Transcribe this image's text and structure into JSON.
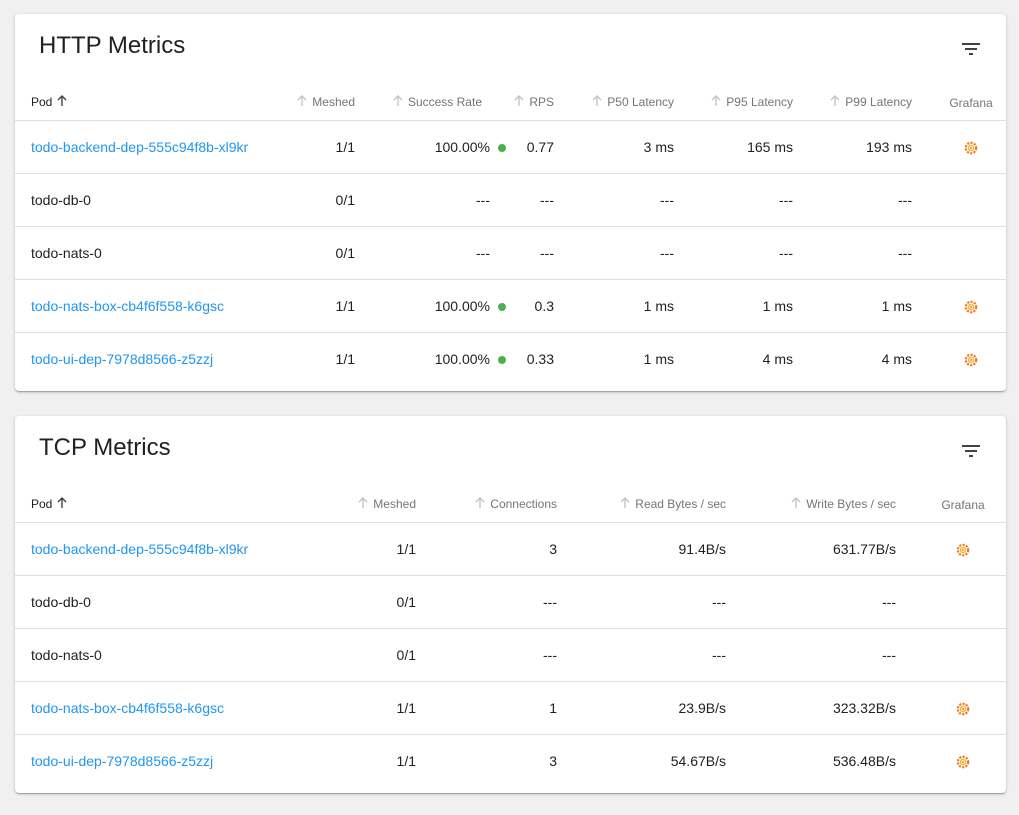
{
  "http": {
    "title": "HTTP Metrics",
    "headers": {
      "pod": "Pod",
      "meshed": "Meshed",
      "success_rate": "Success Rate",
      "rps": "RPS",
      "p50": "P50 Latency",
      "p95": "P95 Latency",
      "p99": "P99 Latency",
      "grafana": "Grafana"
    },
    "rows": [
      {
        "pod": "todo-backend-dep-555c94f8b-xl9kr",
        "linked": true,
        "meshed": "1/1",
        "success_rate": "100.00%",
        "rps": "0.77",
        "p50": "3 ms",
        "p95": "165 ms",
        "p99": "193 ms",
        "grafana": true
      },
      {
        "pod": "todo-db-0",
        "linked": false,
        "meshed": "0/1",
        "success_rate": "---",
        "rps": "---",
        "p50": "---",
        "p95": "---",
        "p99": "---",
        "grafana": false
      },
      {
        "pod": "todo-nats-0",
        "linked": false,
        "meshed": "0/1",
        "success_rate": "---",
        "rps": "---",
        "p50": "---",
        "p95": "---",
        "p99": "---",
        "grafana": false
      },
      {
        "pod": "todo-nats-box-cb4f6f558-k6gsc",
        "linked": true,
        "meshed": "1/1",
        "success_rate": "100.00%",
        "rps": "0.3",
        "p50": "1 ms",
        "p95": "1 ms",
        "p99": "1 ms",
        "grafana": true
      },
      {
        "pod": "todo-ui-dep-7978d8566-z5zzj",
        "linked": true,
        "meshed": "1/1",
        "success_rate": "100.00%",
        "rps": "0.33",
        "p50": "1 ms",
        "p95": "4 ms",
        "p99": "4 ms",
        "grafana": true
      }
    ]
  },
  "tcp": {
    "title": "TCP Metrics",
    "headers": {
      "pod": "Pod",
      "meshed": "Meshed",
      "connections": "Connections",
      "read": "Read Bytes / sec",
      "write": "Write Bytes / sec",
      "grafana": "Grafana"
    },
    "rows": [
      {
        "pod": "todo-backend-dep-555c94f8b-xl9kr",
        "linked": true,
        "meshed": "1/1",
        "connections": "3",
        "read": "91.4B/s",
        "write": "631.77B/s",
        "grafana": true
      },
      {
        "pod": "todo-db-0",
        "linked": false,
        "meshed": "0/1",
        "connections": "---",
        "read": "---",
        "write": "---",
        "grafana": false
      },
      {
        "pod": "todo-nats-0",
        "linked": false,
        "meshed": "0/1",
        "connections": "---",
        "read": "---",
        "write": "---",
        "grafana": false
      },
      {
        "pod": "todo-nats-box-cb4f6f558-k6gsc",
        "linked": true,
        "meshed": "1/1",
        "connections": "1",
        "read": "23.9B/s",
        "write": "323.32B/s",
        "grafana": true
      },
      {
        "pod": "todo-ui-dep-7978d8566-z5zzj",
        "linked": true,
        "meshed": "1/1",
        "connections": "3",
        "read": "54.67B/s",
        "write": "536.48B/s",
        "grafana": true
      }
    ]
  },
  "colors": {
    "link": "#2196f3",
    "success_dot": "#4caf50",
    "grafana_orange": "#f47a20"
  },
  "icons": {
    "filter": "filter-icon",
    "sort": "arrow-up-icon",
    "grafana": "grafana-icon"
  }
}
